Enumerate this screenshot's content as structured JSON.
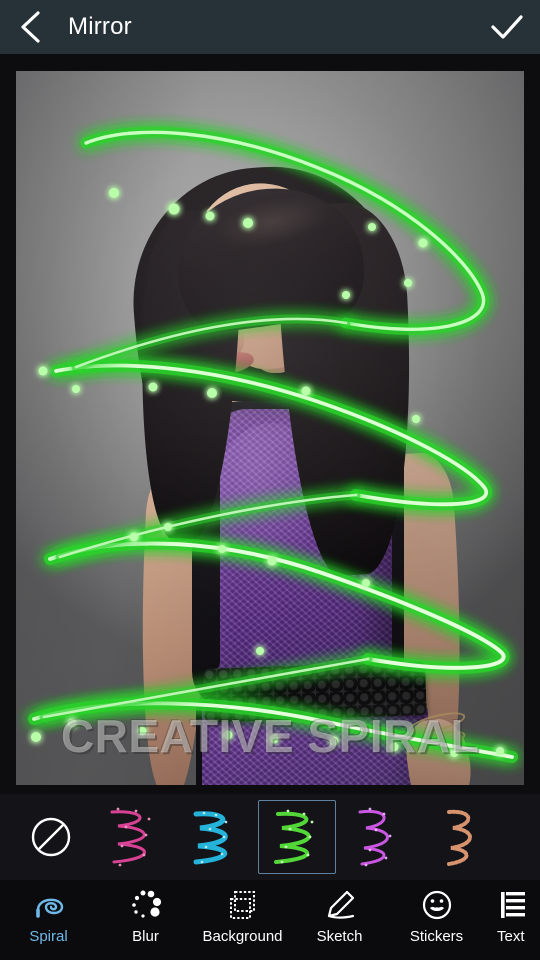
{
  "header": {
    "title": "Mirror",
    "back_icon": "chevron-left-icon",
    "done_icon": "check-icon"
  },
  "canvas": {
    "watermark": "CREATIVE SPIRAL",
    "photo_description": "Portrait of a woman with long dark hair, purple sequin top and skirt, black croc belt, on a gray studio backdrop",
    "active_effect_color": "#3cf03c"
  },
  "effects": {
    "selected_index": 3,
    "items": [
      {
        "name": "no-effect",
        "label": "None",
        "icon": "circle-slash-icon",
        "color": "#ffffff",
        "selected": false
      },
      {
        "name": "spiral-pink",
        "label": "Pink Spiral",
        "icon": "spiral-thumb",
        "color": "#e2459b",
        "selected": false
      },
      {
        "name": "spiral-cyan",
        "label": "Cyan Spiral",
        "icon": "spiral-thumb",
        "color": "#29c9f5",
        "selected": false
      },
      {
        "name": "spiral-green",
        "label": "Green Spiral",
        "icon": "spiral-thumb",
        "color": "#55e03a",
        "selected": true
      },
      {
        "name": "spiral-violet",
        "label": "Violet Spiral",
        "icon": "spiral-thumb",
        "color": "#d45bec",
        "selected": false
      },
      {
        "name": "spiral-orange",
        "label": "Orange Spiral",
        "icon": "spiral-thumb",
        "color": "#e09a72",
        "selected": false
      }
    ]
  },
  "bottom_nav": {
    "active": "Spiral",
    "active_color": "#6fb8e8",
    "items": [
      {
        "label": "Spiral",
        "icon": "spiral-icon",
        "active": true
      },
      {
        "label": "Blur",
        "icon": "blur-dots-icon",
        "active": false
      },
      {
        "label": "Background",
        "icon": "layers-icon",
        "active": false
      },
      {
        "label": "Sketch",
        "icon": "pencil-icon",
        "active": false
      },
      {
        "label": "Stickers",
        "icon": "sticker-face-icon",
        "active": false
      },
      {
        "label": "Text",
        "icon": "text-lines-icon",
        "active": false
      }
    ]
  }
}
